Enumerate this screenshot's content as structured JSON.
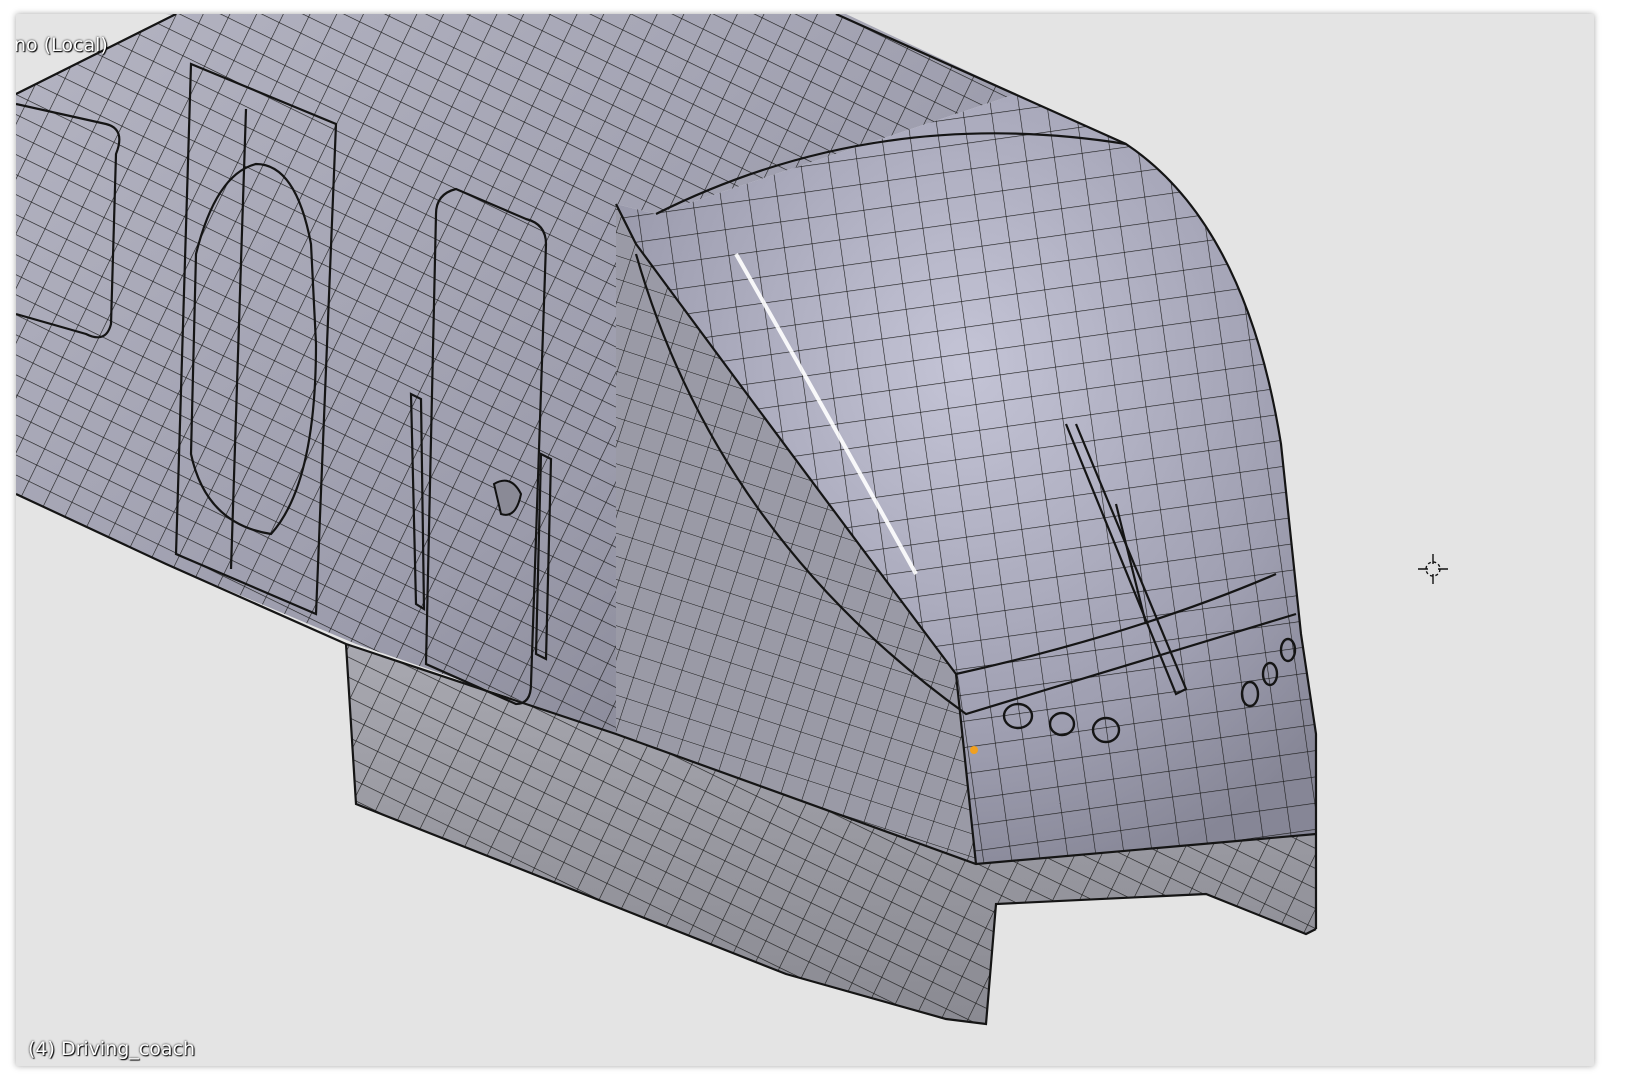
{
  "viewport": {
    "view_label": "no (Local)",
    "object_label": "(4) Driving_coach",
    "background_color": "#e4e4e4",
    "mesh_fill_color": "#9a9aa8",
    "wire_color": "#111111",
    "selected_vertex_color": "#f0a020"
  },
  "icons": {
    "cursor": "3d-cursor-icon"
  }
}
